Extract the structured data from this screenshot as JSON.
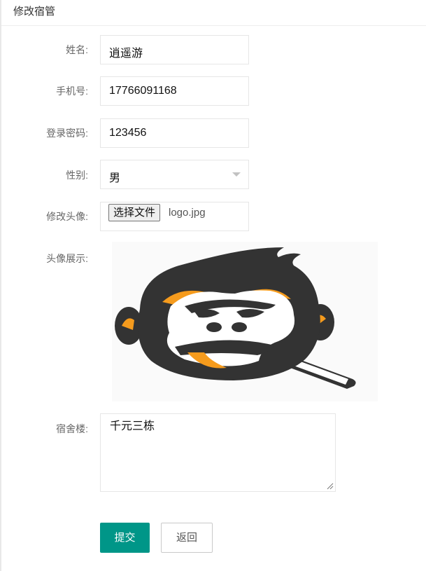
{
  "header": {
    "title": "修改宿管"
  },
  "form": {
    "name": {
      "label": "姓名:",
      "value": "逍遥游"
    },
    "phone": {
      "label": "手机号:",
      "value": "17766091168"
    },
    "password": {
      "label": "登录密码:",
      "value": "123456"
    },
    "gender": {
      "label": "性别:",
      "value": "男"
    },
    "avatar_upload": {
      "label": "修改头像:",
      "button": "选择文件",
      "file": "logo.jpg"
    },
    "avatar_preview": {
      "label": "头像展示:"
    },
    "building": {
      "label": "宿舍楼:",
      "value": "千元三栋"
    }
  },
  "buttons": {
    "submit": "提交",
    "back": "返回"
  },
  "colors": {
    "primary": "#009688",
    "logo_dark": "#333333",
    "logo_accent": "#f59b1d"
  }
}
